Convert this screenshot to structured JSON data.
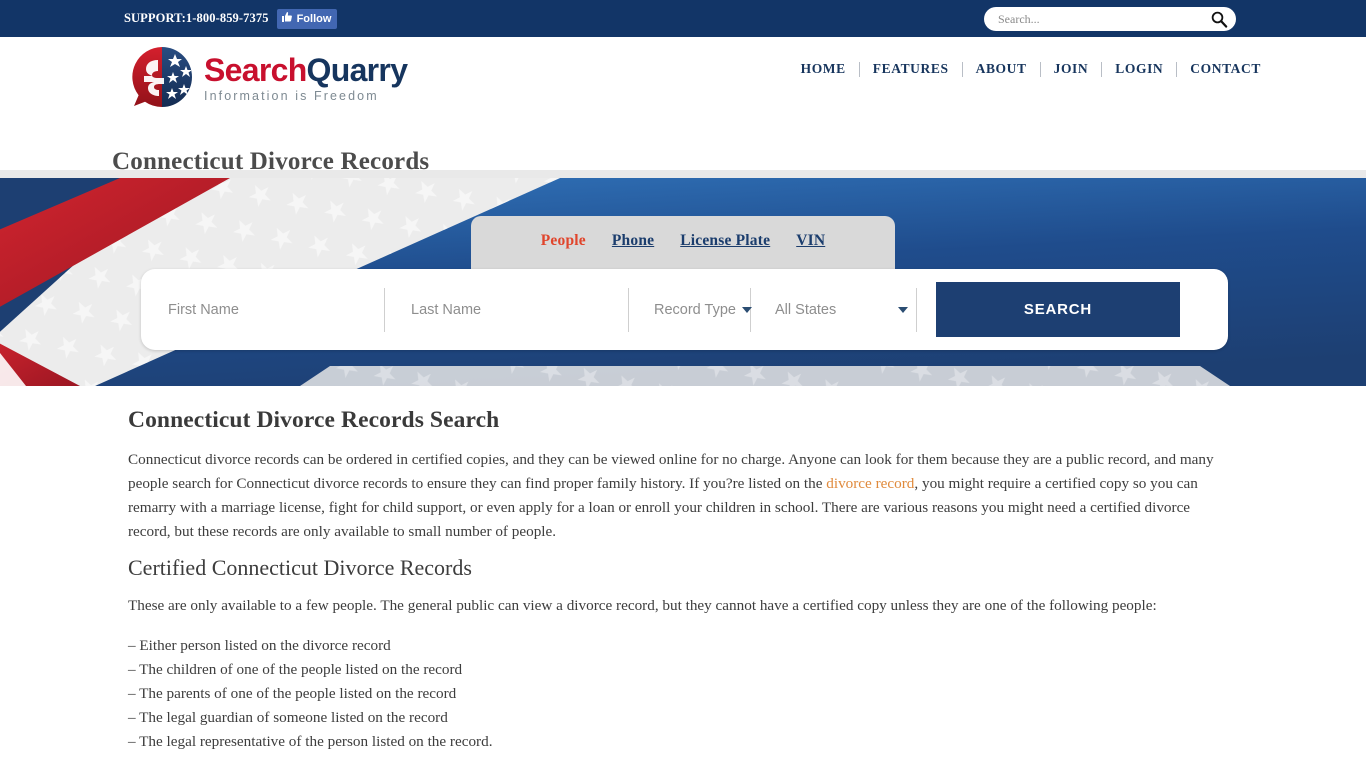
{
  "topbar": {
    "support": "SUPPORT:1-800-859-7375",
    "follow_label": "Follow",
    "search_placeholder": "Search...",
    "search_value": ""
  },
  "brand": {
    "word_1": "Search",
    "word_2": "Quarry",
    "tagline": "Information is Freedom"
  },
  "nav": {
    "items": [
      {
        "label": "HOME"
      },
      {
        "label": "FEATURES"
      },
      {
        "label": "ABOUT"
      },
      {
        "label": "JOIN"
      },
      {
        "label": "LOGIN"
      },
      {
        "label": "CONTACT"
      }
    ]
  },
  "page": {
    "title": "Connecticut Divorce Records"
  },
  "search_widget": {
    "tabs": [
      {
        "label": "People",
        "active": true
      },
      {
        "label": "Phone",
        "active": false
      },
      {
        "label": "License Plate",
        "active": false
      },
      {
        "label": "VIN",
        "active": false
      }
    ],
    "first_name_placeholder": "First Name",
    "first_name_value": "",
    "last_name_placeholder": "Last Name",
    "last_name_value": "",
    "record_type_label": "Record Type",
    "state_label": "All States",
    "search_button": "SEARCH"
  },
  "content": {
    "heading": "Connecticut Divorce Records Search",
    "paragraph_1_part_1": "Connecticut divorce records can be ordered in certified copies, and they can be viewed online for no charge. Anyone can look for them because they are a public record, and many people search for Connecticut divorce records to ensure they can find proper family history. If you?re listed on the ",
    "paragraph_1_link": "divorce record",
    "paragraph_1_part_2": ", you might require a certified copy so you can remarry with a marriage license, fight for child support, or even apply for a loan or enroll your children in school. There are various reasons you might need a certified divorce record, but these records are only available to small number of people.",
    "subheading": "Certified Connecticut Divorce Records",
    "paragraph_2": "These are only available to a few people. The general public can view a divorce record, but they cannot have a certified copy unless they are one of the following people:",
    "list": [
      "– Either person listed on the divorce record",
      "– The children of one of the people listed on the record",
      "– The parents of one of the people listed on the record",
      "– The legal guardian of someone listed on the record",
      "– The legal representative of the person listed on the record."
    ]
  },
  "colors": {
    "navy": "#1d3f72",
    "topbar_navy": "#123567",
    "brand_red": "#C8102E",
    "tab_active": "#e0452c",
    "link_orange": "#e08a3c",
    "facebook_blue": "#4267B2"
  }
}
